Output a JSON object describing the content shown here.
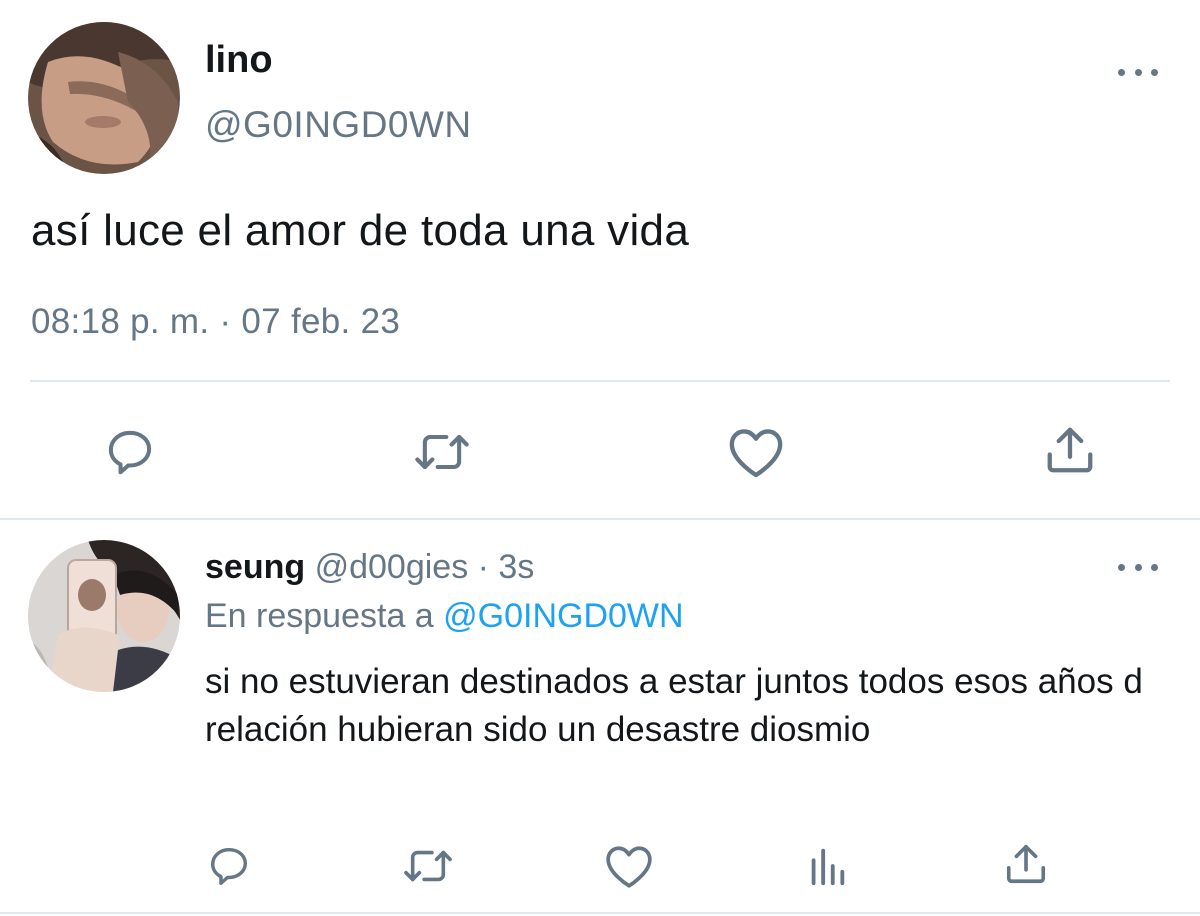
{
  "tweet": {
    "author_name": "lino",
    "author_handle": "@G0INGD0WN",
    "text": "así luce el amor de toda una vida",
    "timestamp": "08:18 p. m. · 07 feb. 23",
    "actions": [
      "reply-icon",
      "retweet-icon",
      "like-icon",
      "share-icon"
    ]
  },
  "reply": {
    "author_name": "seung",
    "author_handle": "@d00gies",
    "time_ago": "3s",
    "separator": " · ",
    "replying_to_label": "En respuesta a",
    "replying_to_handle": "@G0INGD0WN",
    "text": "si no estuvieran destinados a estar juntos todos esos años d relación hubieran sido un desastre diosmio",
    "actions": [
      "reply-icon",
      "retweet-icon",
      "like-icon",
      "analytics-icon",
      "share-icon"
    ]
  },
  "colors": {
    "text_primary": "#14171a",
    "text_secondary": "#657786",
    "link": "#1da1f2",
    "divider": "#e1e8ed"
  }
}
